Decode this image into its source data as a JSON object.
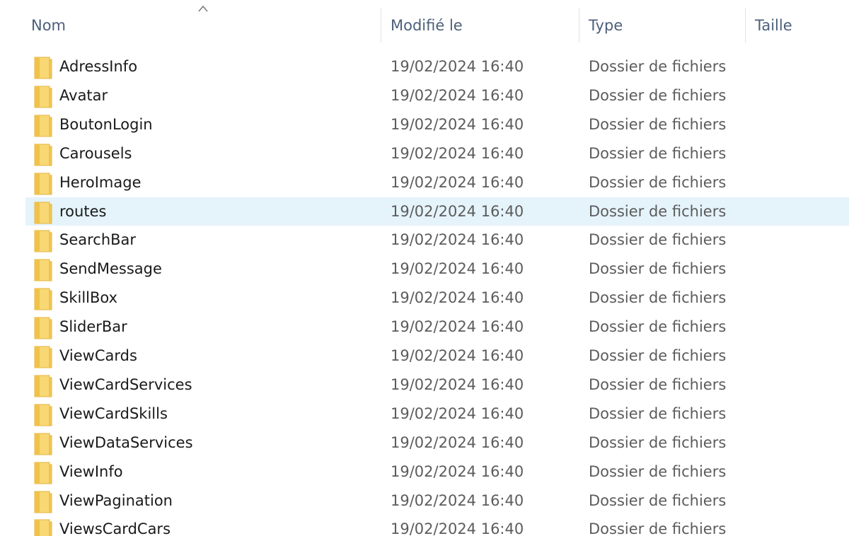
{
  "columns": {
    "name": "Nom",
    "modified": "Modifié le",
    "type": "Type",
    "size": "Taille"
  },
  "selected_index": 5,
  "colors": {
    "selection": "#e5f3fb",
    "folder": "#f5c542",
    "header_text": "#4d5f7a"
  },
  "rows": [
    {
      "name": "AdressInfo",
      "modified": "19/02/2024 16:40",
      "type": "Dossier de fichiers"
    },
    {
      "name": "Avatar",
      "modified": "19/02/2024 16:40",
      "type": "Dossier de fichiers"
    },
    {
      "name": "BoutonLogin",
      "modified": "19/02/2024 16:40",
      "type": "Dossier de fichiers"
    },
    {
      "name": "Carousels",
      "modified": "19/02/2024 16:40",
      "type": "Dossier de fichiers"
    },
    {
      "name": "HeroImage",
      "modified": "19/02/2024 16:40",
      "type": "Dossier de fichiers"
    },
    {
      "name": "routes",
      "modified": "19/02/2024 16:40",
      "type": "Dossier de fichiers"
    },
    {
      "name": "SearchBar",
      "modified": "19/02/2024 16:40",
      "type": "Dossier de fichiers"
    },
    {
      "name": "SendMessage",
      "modified": "19/02/2024 16:40",
      "type": "Dossier de fichiers"
    },
    {
      "name": "SkillBox",
      "modified": "19/02/2024 16:40",
      "type": "Dossier de fichiers"
    },
    {
      "name": "SliderBar",
      "modified": "19/02/2024 16:40",
      "type": "Dossier de fichiers"
    },
    {
      "name": "ViewCards",
      "modified": "19/02/2024 16:40",
      "type": "Dossier de fichiers"
    },
    {
      "name": "ViewCardServices",
      "modified": "19/02/2024 16:40",
      "type": "Dossier de fichiers"
    },
    {
      "name": "ViewCardSkills",
      "modified": "19/02/2024 16:40",
      "type": "Dossier de fichiers"
    },
    {
      "name": "ViewDataServices",
      "modified": "19/02/2024 16:40",
      "type": "Dossier de fichiers"
    },
    {
      "name": "ViewInfo",
      "modified": "19/02/2024 16:40",
      "type": "Dossier de fichiers"
    },
    {
      "name": "ViewPagination",
      "modified": "19/02/2024 16:40",
      "type": "Dossier de fichiers"
    },
    {
      "name": "ViewsCardCars",
      "modified": "19/02/2024 16:40",
      "type": "Dossier de fichiers"
    }
  ]
}
